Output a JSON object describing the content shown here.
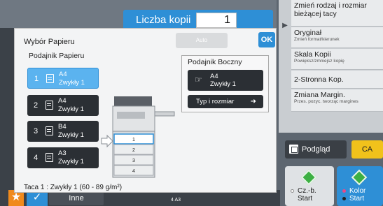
{
  "copies": {
    "label": "Liczba kopii",
    "value": "1"
  },
  "right_menu": [
    {
      "title": "Zmień rodzaj i rozmiar bieżącej tacy",
      "subtitle": ""
    },
    {
      "title": "Oryginał",
      "subtitle": "Zmień format/kierunek"
    },
    {
      "title": "Skala Kopii",
      "subtitle": "Powiększ/zmniejsz kopię"
    },
    {
      "title": "2-Stronna Kop.",
      "subtitle": ""
    },
    {
      "title": "Zmiana Margin.",
      "subtitle": "Przes. pozyc. tworząc margines"
    }
  ],
  "actions": {
    "preview": "Podgląd",
    "ca": "CA",
    "start_bw": "Cz.-b.",
    "start_color": "Kolor",
    "start_word": "Start"
  },
  "bottom": {
    "other": "Inne",
    "tray_info": "4    A3"
  },
  "dialog": {
    "title": "Wybór Papieru",
    "disabled_button": "Auto",
    "ok": "OK",
    "tray_section": "Podajnik Papieru",
    "trays": [
      {
        "num": "1",
        "size": "A4",
        "type": "Zwykły 1",
        "selected": true
      },
      {
        "num": "2",
        "size": "A4",
        "type": "Zwykły 1",
        "selected": false
      },
      {
        "num": "3",
        "size": "B4",
        "type": "Zwykły 1",
        "selected": false
      },
      {
        "num": "4",
        "size": "A3",
        "type": "Zwykły 1",
        "selected": false
      }
    ],
    "side_tray": {
      "title": "Podajnik Boczny",
      "size": "A4",
      "type": "Zwykły 1",
      "type_size_button": "Typ i rozmiar"
    },
    "printer_trays": [
      "1",
      "2",
      "3",
      "4"
    ],
    "footer": "Taca 1 : Zwykły 1 (60 - 89 g/m²)"
  },
  "colors": {
    "accent": "#2e8fd6",
    "ca": "#f1c21b",
    "star": "#f08a1c",
    "start_green": "#3cb043"
  }
}
